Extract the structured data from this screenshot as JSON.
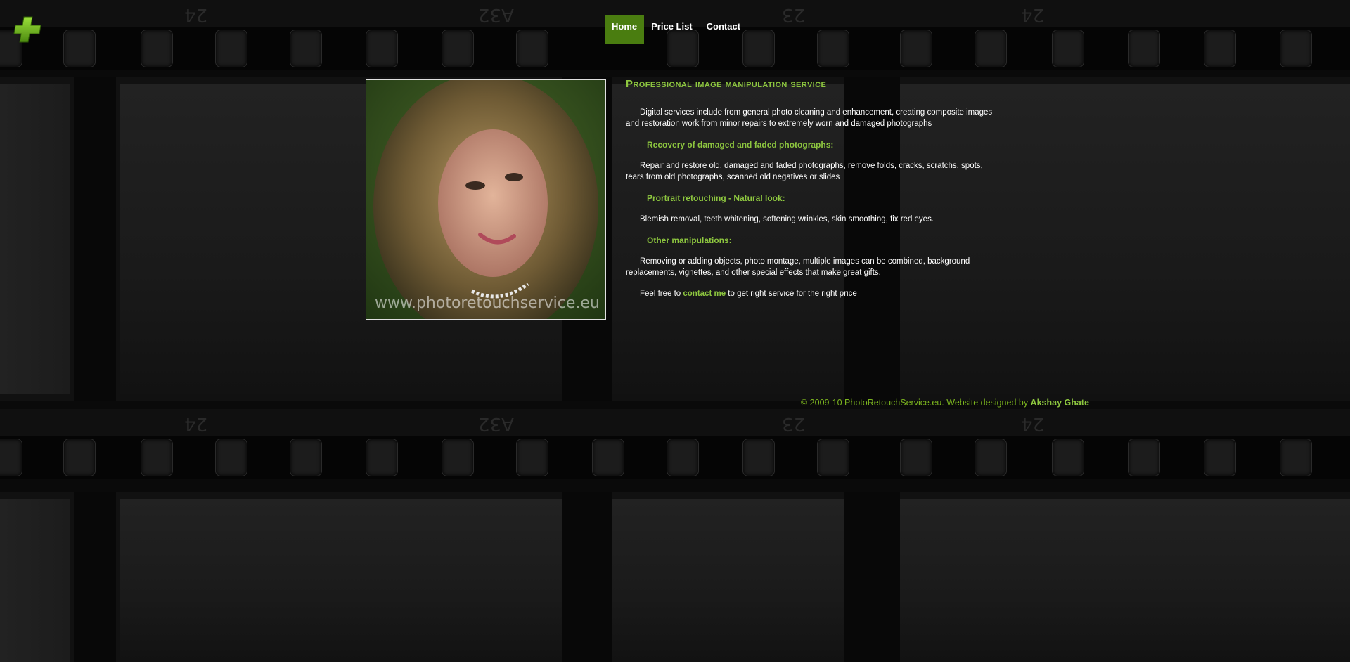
{
  "nav": {
    "items": [
      {
        "label": "Home",
        "active": true
      },
      {
        "label": "Price List",
        "active": false
      },
      {
        "label": "Contact",
        "active": false
      }
    ]
  },
  "photo": {
    "watermark": "www.photoretouchservice.eu"
  },
  "main": {
    "title": "Professional image manipulation service",
    "intro": "Digital services include from general photo cleaning and enhancement, creating composite images and restoration work from minor repairs to extremely worn and damaged photographs",
    "sections": [
      {
        "heading": "Recovery of damaged and faded photographs:",
        "text": "Repair and restore old, damaged and faded photographs, remove folds, cracks, scratchs, spots, tears from old photographs, scanned old negatives or slides"
      },
      {
        "heading": "Prortrait retouching - Natural look:",
        "text": "Blemish removal, teeth whitening, softening wrinkles, skin smoothing, fix red eyes."
      },
      {
        "heading": "Other manipulations:",
        "text": "Removing or adding objects, photo montage, multiple images can be combined, background replacements, vignettes, and other special effects that make great gifts."
      }
    ],
    "closing_prefix": "Feel free to ",
    "closing_link": "contact me",
    "closing_suffix": " to get right service for the right price"
  },
  "footer": {
    "text": "© 2009-10 PhotoRetouchService.eu. Website designed by ",
    "designer": "Akshay Ghate"
  },
  "colors": {
    "accent": "#8dc63f",
    "nav_active": "#4a7d10",
    "background": "#0a0a0a"
  },
  "icons": {
    "logo": "green-plus-icon"
  },
  "film_frame_numbers": [
    "24",
    "A32",
    "23",
    "24"
  ]
}
